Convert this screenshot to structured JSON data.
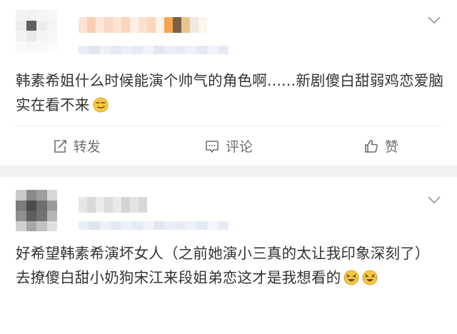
{
  "colors": {
    "text": "#333333",
    "action_text": "#6f6f6f",
    "separator": "#f2f2f2",
    "emoji_yellow": "#f7c744"
  },
  "posts": [
    {
      "content": "韩素希姐什么时候能演个帅气的角色啊......新剧傻白甜弱鸡恋爱脑实在看不来",
      "emojis": [
        "smirk-emoji"
      ],
      "actions": {
        "repost": "转发",
        "comment": "评论",
        "like": "赞"
      }
    },
    {
      "content": "好希望韩素希演坏女人（之前她演小三真的太让我印象深刻了）去撩傻白甜小奶狗宋江来段姐弟恋这才是我想看的",
      "emojis": [
        "laugh-cry-emoji",
        "laugh-cry-emoji"
      ]
    }
  ],
  "icons": [
    "chevron-down-icon",
    "repost-icon",
    "comment-icon",
    "like-icon"
  ]
}
